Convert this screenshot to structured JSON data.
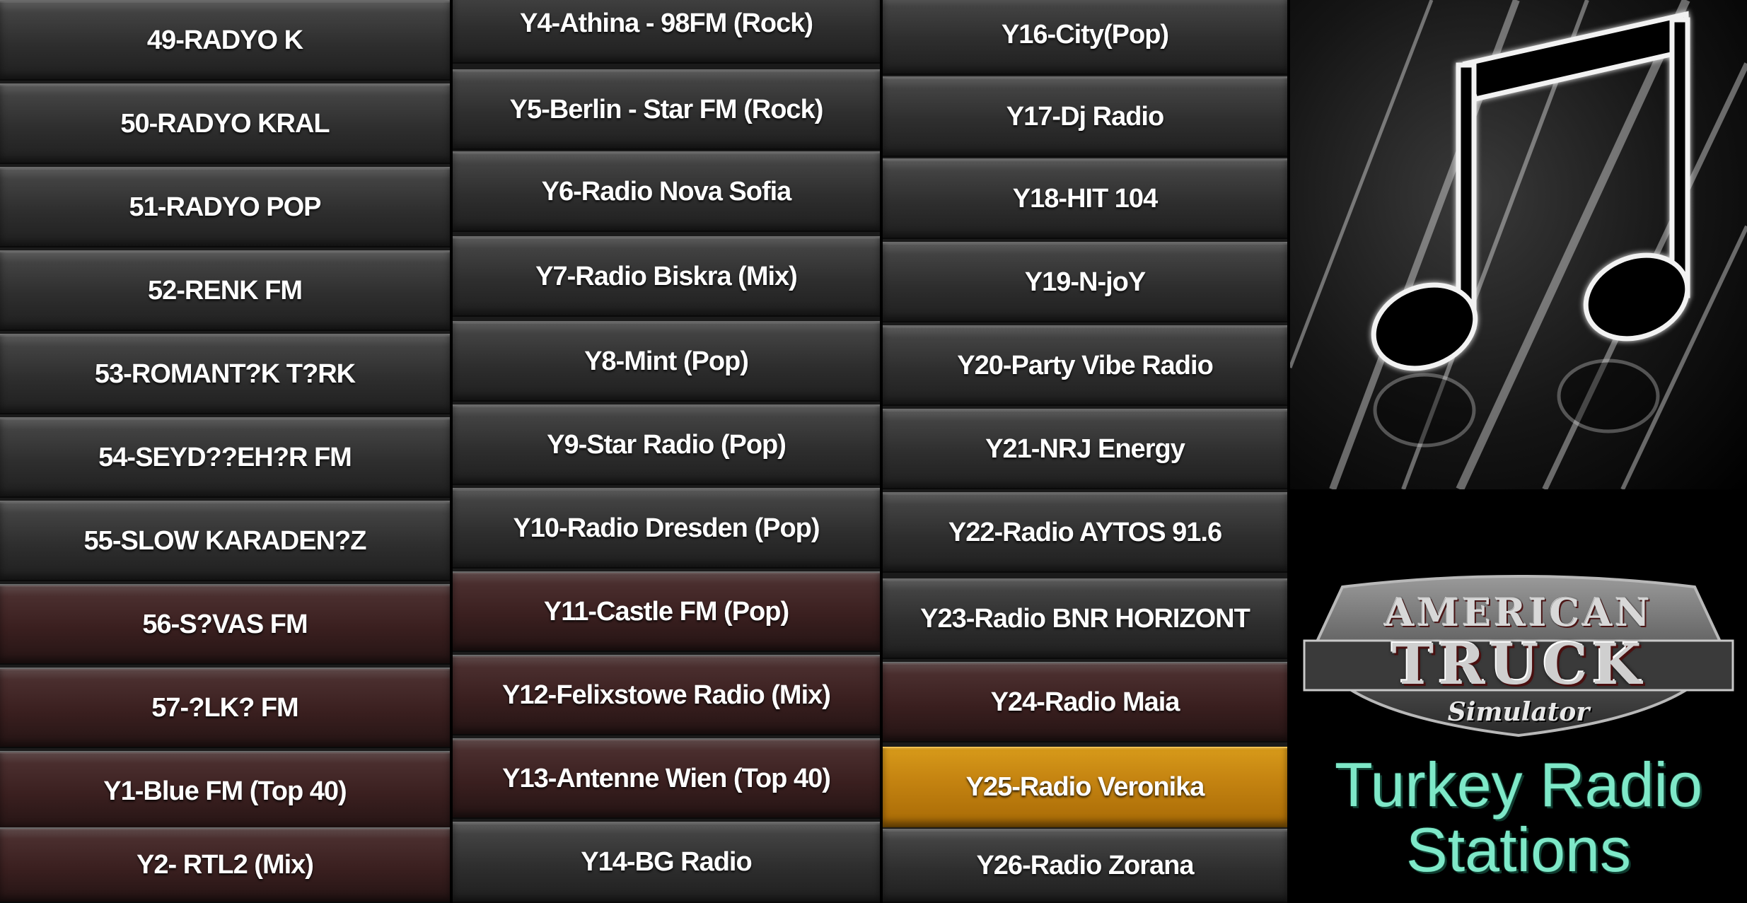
{
  "columns": [
    {
      "stations": [
        "49-RADYO K",
        "50-RADYO KRAL",
        "51-RADYO POP",
        "52-RENK FM",
        "53-ROMANT?K T?RK",
        "54-SEYD??EH?R FM",
        "55-SLOW KARADEN?Z",
        "56-S?VAS FM",
        "57-?LK? FM",
        "Y1-Blue FM (Top 40)",
        "Y2- RTL2 (Mix)"
      ]
    },
    {
      "stations": [
        "Y4-Athina - 98FM (Rock)",
        "Y5-Berlin - Star FM (Rock)",
        "Y6-Radio Nova Sofia",
        "Y7-Radio Biskra (Mix)",
        "Y8-Mint (Pop)",
        "Y9-Star Radio (Pop)",
        "Y10-Radio Dresden (Pop)",
        "Y11-Castle FM (Pop)",
        "Y12-Felixstowe Radio (Mix)",
        "Y13-Antenne Wien (Top 40)",
        "Y14-BG Radio"
      ]
    },
    {
      "stations": [
        "Y16-City(Pop)",
        "Y17-Dj Radio",
        "Y18-HIT 104",
        "Y19-N-joY",
        "Y20-Party Vibe Radio",
        "Y21-NRJ Energy",
        "Y22-Radio AYTOS 91.6",
        "Y23-Radio BNR HORIZONT",
        "Y24-Radio Maia",
        "Y25-Radio Veronika",
        "Y26-Radio Zorana"
      ],
      "selected": "Y25-Radio Veronika"
    }
  ],
  "icons": {
    "music": "music-note-icon"
  },
  "logo": {
    "line1": "AMERICAN",
    "line2": "TRUCK",
    "line3": "Simulator"
  },
  "panel_title": {
    "line1": "Turkey Radio",
    "line2": "Stations"
  },
  "colors": {
    "selected_row": "#c58411",
    "title_text": "#7ee8c8",
    "row_text": "#ffffff"
  }
}
